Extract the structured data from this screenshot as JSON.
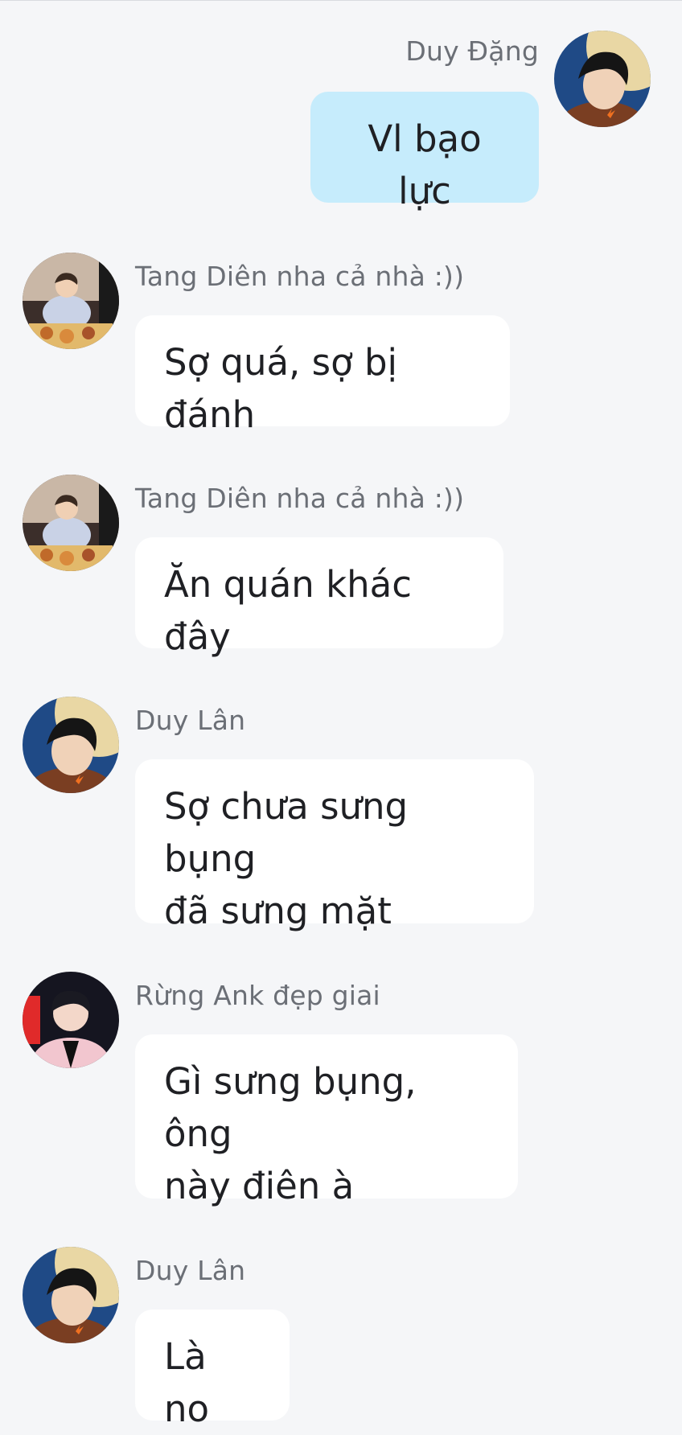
{
  "messages": [
    {
      "sender": "Duy Đặng",
      "text": "Vl bạo lực",
      "side": "out",
      "avatar": "avatar-duy-dang"
    },
    {
      "sender": "Tang Diên nha cả nhà :))",
      "text": "Sợ quá, sợ bị đánh",
      "side": "in",
      "avatar": "avatar-tang-dien"
    },
    {
      "sender": "Tang Diên nha cả nhà :))",
      "text": "Ăn quán khác đây",
      "side": "in",
      "avatar": "avatar-tang-dien"
    },
    {
      "sender": "Duy Lân",
      "text": "Sợ chưa sưng bụng\nđã sưng mặt",
      "side": "in",
      "avatar": "avatar-duy-lan"
    },
    {
      "sender": "Rừng Ank đẹp giai",
      "text": "Gì sưng bụng, ông\nnày điên à",
      "side": "in",
      "avatar": "avatar-rung-ank"
    },
    {
      "sender": "Duy Lân",
      "text": "Là no",
      "side": "in",
      "avatar": "avatar-duy-lan"
    }
  ],
  "colors": {
    "background": "#f5f6f8",
    "incoming_bubble": "#ffffff",
    "outgoing_bubble": "#c6ecfc",
    "sender_name": "#6b6f76",
    "message_text": "#1f2024"
  }
}
